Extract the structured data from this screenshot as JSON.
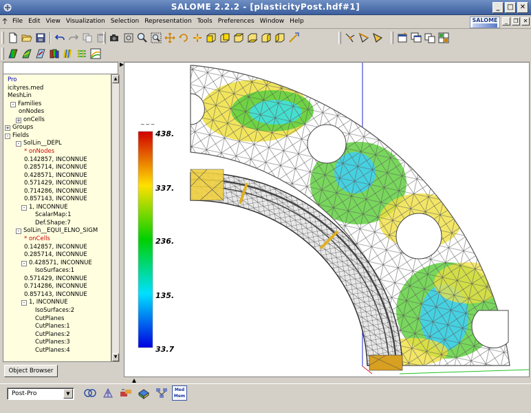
{
  "window": {
    "title": "SALOME 2.2.2 - [plasticityPost.hdf#1]",
    "buttons": [
      "_",
      "□",
      "✕"
    ]
  },
  "menubar": {
    "items": [
      "File",
      "Edit",
      "View",
      "Visualization",
      "Selection",
      "Representation",
      "Tools",
      "Preferences",
      "Window",
      "Help"
    ],
    "logo_text": "SALOME"
  },
  "toolbar1": {
    "std_icons": [
      "new-icon",
      "open-icon",
      "save-icon",
      "undo-icon",
      "redo-icon",
      "copy-icon",
      "paste-icon"
    ],
    "view_icons": [
      "camera-icon",
      "fit-all-icon",
      "zoom-icon",
      "fit-area-icon",
      "pan-icon",
      "rotate-icon",
      "global-pan-icon",
      "front-view-icon",
      "back-view-icon",
      "top-view-icon",
      "bottom-view-icon",
      "left-view-icon",
      "right-view-icon",
      "reset-icon"
    ],
    "select_icons": [
      "select-point-icon",
      "select-edge-icon",
      "select-cell-icon"
    ],
    "window_icons": [
      "new-window-icon",
      "cascade-icon",
      "tile-icon",
      "split-icon"
    ]
  },
  "toolbar2": {
    "icons": [
      "scalar-map-icon",
      "deformed-shape-icon",
      "vectors-icon",
      "iso-surfaces-icon",
      "cut-planes-icon",
      "cut-lines-icon",
      "stream-lines-icon"
    ]
  },
  "object_browser": {
    "tab_label": "Object Browser",
    "rows": [
      {
        "text": "Pro",
        "indent": 0,
        "color": "blue"
      },
      {
        "text": "icityres.med",
        "indent": 0
      },
      {
        "text": "MeshLin",
        "indent": 0
      },
      {
        "text": "Families",
        "indent": 1,
        "exp": "-"
      },
      {
        "text": "onNodes",
        "indent": 2
      },
      {
        "text": "onCells",
        "indent": 2,
        "exp": "+"
      },
      {
        "text": "Groups",
        "indent": 0,
        "exp": "+"
      },
      {
        "text": "Fields",
        "indent": 0,
        "exp": "-"
      },
      {
        "text": "SolLin__DEPL",
        "indent": 2,
        "exp": "-"
      },
      {
        "text": "* onNodes",
        "indent": 3,
        "color": "red"
      },
      {
        "text": "0.142857, INCONNUE",
        "indent": 3
      },
      {
        "text": "0.285714, INCONNUE",
        "indent": 3
      },
      {
        "text": "0.428571, INCONNUE",
        "indent": 3
      },
      {
        "text": "0.571429, INCONNUE",
        "indent": 3
      },
      {
        "text": "0.714286, INCONNUE",
        "indent": 3
      },
      {
        "text": "0.857143, INCONNUE",
        "indent": 3
      },
      {
        "text": "1, INCONNUE",
        "indent": 3,
        "exp": "-"
      },
      {
        "text": "ScalarMap:1",
        "indent": 5
      },
      {
        "text": "Def.Shape:7",
        "indent": 5
      },
      {
        "text": "SolLin__EQUI_ELNO_SIGM",
        "indent": 2,
        "exp": "-"
      },
      {
        "text": "* onCells",
        "indent": 3,
        "color": "red"
      },
      {
        "text": "0.142857, INCONNUE",
        "indent": 3
      },
      {
        "text": "0.285714, INCONNUE",
        "indent": 3
      },
      {
        "text": "0.428571, INCONNUE",
        "indent": 3,
        "exp": "-"
      },
      {
        "text": "IsoSurfaces:1",
        "indent": 5
      },
      {
        "text": "0.571429, INCONNUE",
        "indent": 3
      },
      {
        "text": "0.714286, INCONNUE",
        "indent": 3
      },
      {
        "text": "0.857143, INCONNUE",
        "indent": 3
      },
      {
        "text": "1, INCONNUE",
        "indent": 3,
        "exp": "-"
      },
      {
        "text": "IsoSurfaces:2",
        "indent": 5
      },
      {
        "text": "CutPlanes",
        "indent": 5
      },
      {
        "text": "CutPlanes:1",
        "indent": 5
      },
      {
        "text": "CutPlanes:2",
        "indent": 5
      },
      {
        "text": "CutPlanes:3",
        "indent": 5
      },
      {
        "text": "CutPlanes:4",
        "indent": 5
      }
    ]
  },
  "viewer": {
    "scalar_bar": {
      "title": "_ _ _",
      "labels": [
        "438.",
        "337.",
        "236.",
        "135.",
        "33.7"
      ],
      "colors": [
        "#d00000",
        "#ffe000",
        "#00d000",
        "#00e0ff",
        "#0000e0"
      ]
    },
    "colors": {
      "mesh": "#5a5a5a",
      "axis_blue": "#2020d0",
      "axis_green": "#20c020",
      "axis_red": "#d02020"
    }
  },
  "statusbar": {
    "module_combo": "Post-Pro",
    "module_icons": [
      "geometry-icon",
      "mesh-icon",
      "supervisor-icon",
      "post-pro-icon",
      "component-icon",
      "med-icon"
    ],
    "med_label_1": "Med",
    "med_label_2": "Mem"
  }
}
